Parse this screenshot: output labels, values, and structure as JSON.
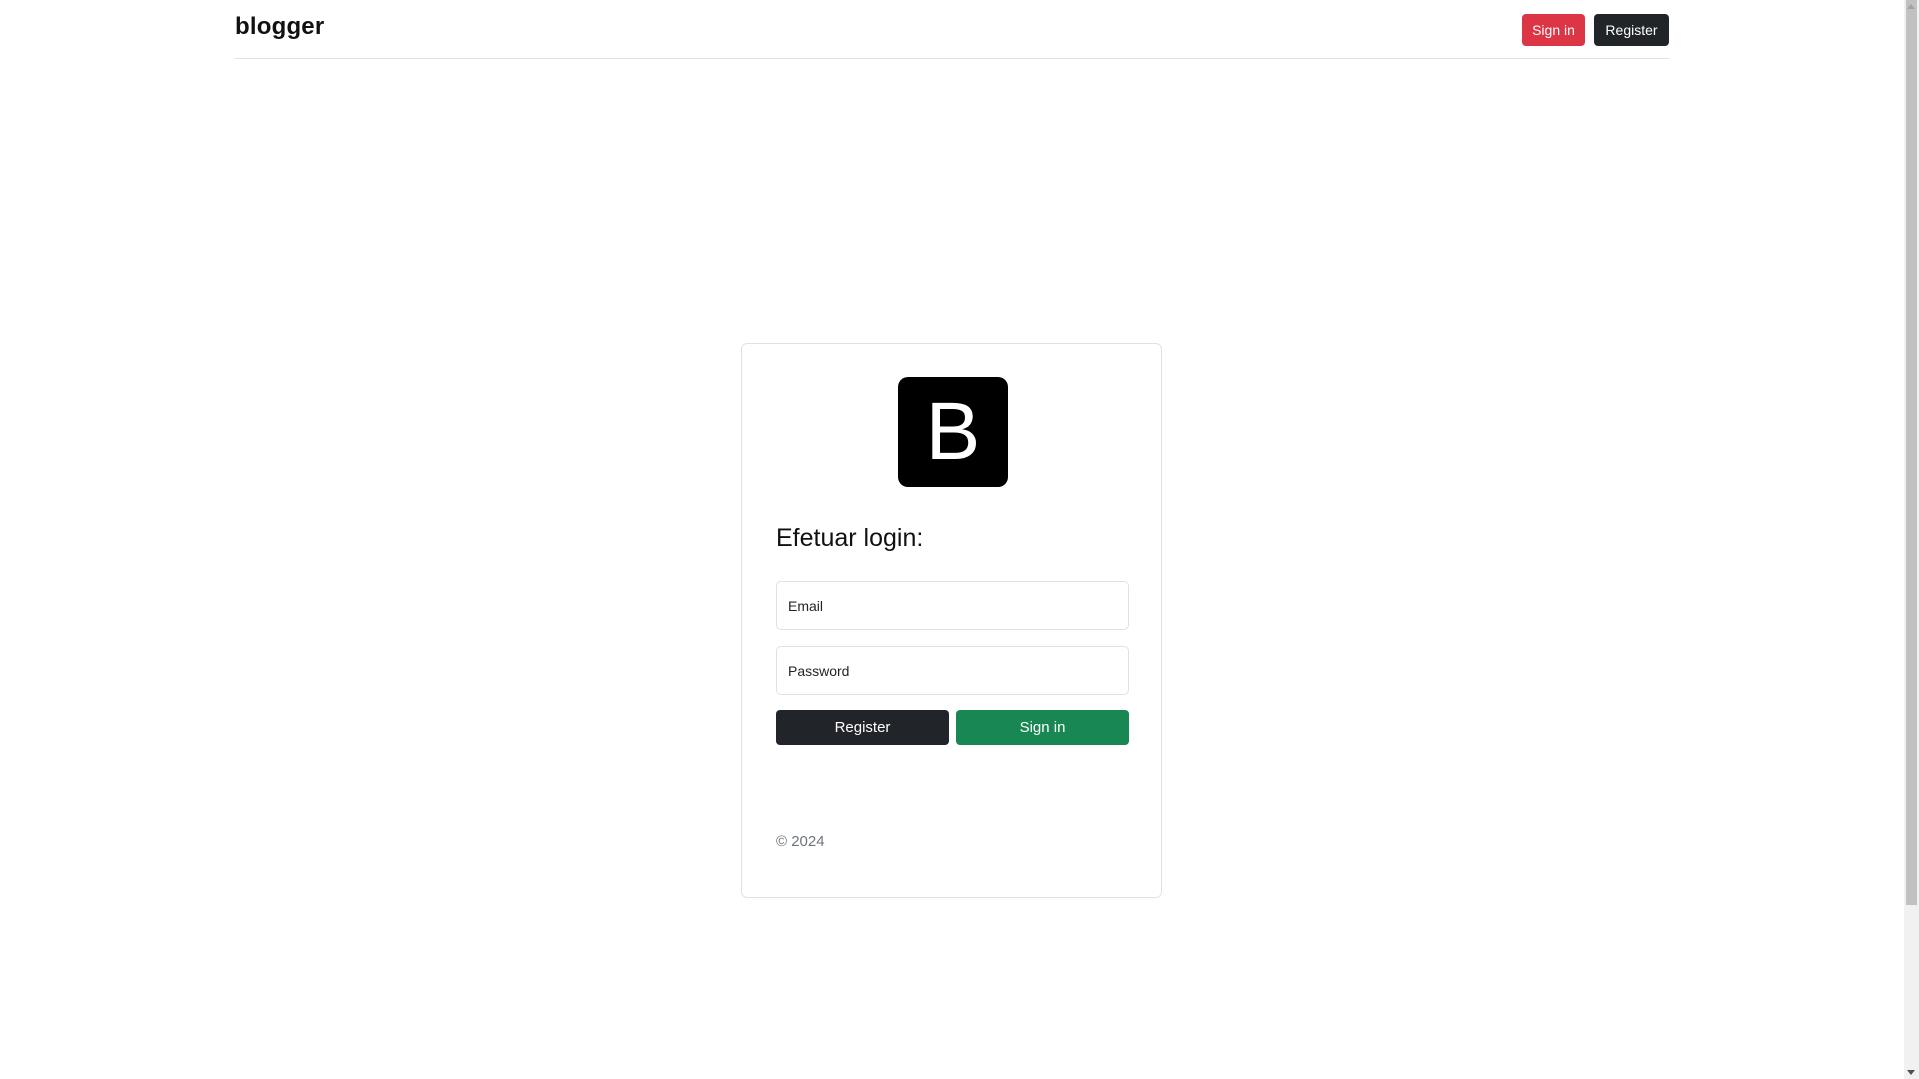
{
  "header": {
    "brand": "blogger",
    "signin_label": "Sign in",
    "register_label": "Register"
  },
  "login_card": {
    "logo_letter": "B",
    "title": "Efetuar login:",
    "email_placeholder": "Email",
    "password_placeholder": "Password",
    "register_label": "Register",
    "signin_label": "Sign in",
    "copyright": "© 2024"
  },
  "colors": {
    "danger": "#dc3545",
    "dark": "#212529",
    "success": "#198754"
  },
  "icons": {
    "logo": "bootstrap-b-logo"
  }
}
